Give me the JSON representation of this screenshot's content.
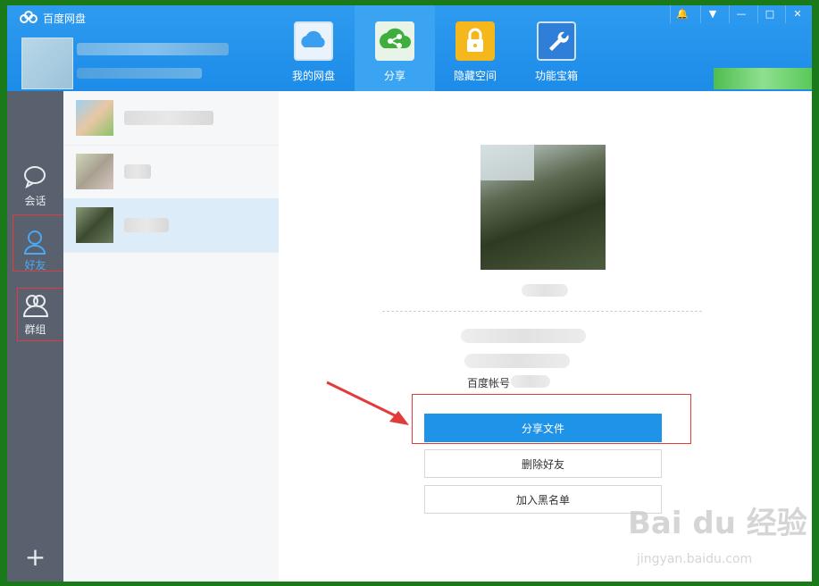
{
  "window": {
    "title": "百度网盘"
  },
  "nav": [
    {
      "label": "我的网盘",
      "icon": "cloud-icon"
    },
    {
      "label": "分享",
      "icon": "share-icon",
      "active": true
    },
    {
      "label": "隐藏空间",
      "icon": "lock-icon"
    },
    {
      "label": "功能宝箱",
      "icon": "wrench-icon"
    }
  ],
  "window_controls": {
    "bell": "🔔",
    "menu": "▼",
    "minimize": "—",
    "maximize": "□",
    "close": "✕"
  },
  "sidebar": [
    {
      "label": "会话",
      "icon": "chat-bubble-icon"
    },
    {
      "label": "好友",
      "icon": "friend-icon",
      "active": true
    },
    {
      "label": "群组",
      "icon": "group-icon"
    }
  ],
  "sidebar_add": "+",
  "detail": {
    "account_label": "百度帐号",
    "buttons": {
      "share_files": "分享文件",
      "delete_friend": "删除好友",
      "add_blacklist": "加入黑名单"
    }
  },
  "watermark": {
    "main": "Bai du 经验",
    "sub": "jingyan.baidu.com"
  },
  "colors": {
    "brand": "#1d8ce8",
    "sidebar": "#58616d",
    "primary_button": "#1f93e8",
    "annotation": "#e23b3b"
  }
}
